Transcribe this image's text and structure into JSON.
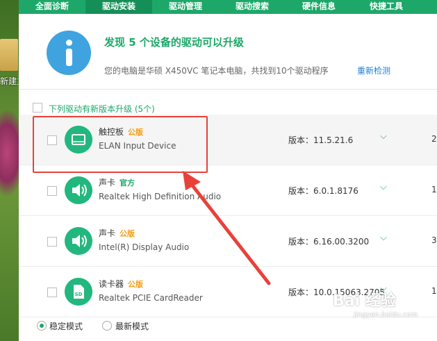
{
  "desktop": {
    "folder_label": "新建文"
  },
  "tabs": [
    {
      "label": "全面诊断"
    },
    {
      "label": "驱动安装"
    },
    {
      "label": "驱动管理"
    },
    {
      "label": "驱动搜索"
    },
    {
      "label": "硬件信息"
    },
    {
      "label": "快捷工具"
    }
  ],
  "hero": {
    "title": "发现 5 个设备的驱动可以升级",
    "subtitle": "您的电脑是华硕 X450VC 笔记本电脑，共找到10个驱动程序",
    "rescan": "重新检测"
  },
  "section": {
    "label": "下列驱动有新版本升级 (5个)"
  },
  "drivers": [
    {
      "name": "触控板",
      "badge": "公版",
      "model": "ELAN Input Device",
      "version": "版本：11.5.21.6",
      "right": "2"
    },
    {
      "name": "声卡",
      "badge": "官方",
      "model": "Realtek High Definition Audio",
      "version": "版本：6.0.1.8176",
      "right": "1"
    },
    {
      "name": "声卡",
      "badge": "公版",
      "model": "Intel(R) Display Audio",
      "version": "版本：6.16.00.3200",
      "right": "3"
    },
    {
      "name": "读卡器",
      "badge": "公版",
      "model": "Realtek PCIE CardReader",
      "version": "版本：10.0.15063.2705",
      "right": "1"
    }
  ],
  "modes": {
    "stable": "稳定模式",
    "latest": "最新模式"
  },
  "watermark": {
    "text": "Bai 经验",
    "url": "jingyan.baidu.com"
  },
  "colors": {
    "accent": "#1da86a",
    "badge_public": "#f39c12",
    "link": "#1f7fd1",
    "highlight": "#e8413a"
  }
}
